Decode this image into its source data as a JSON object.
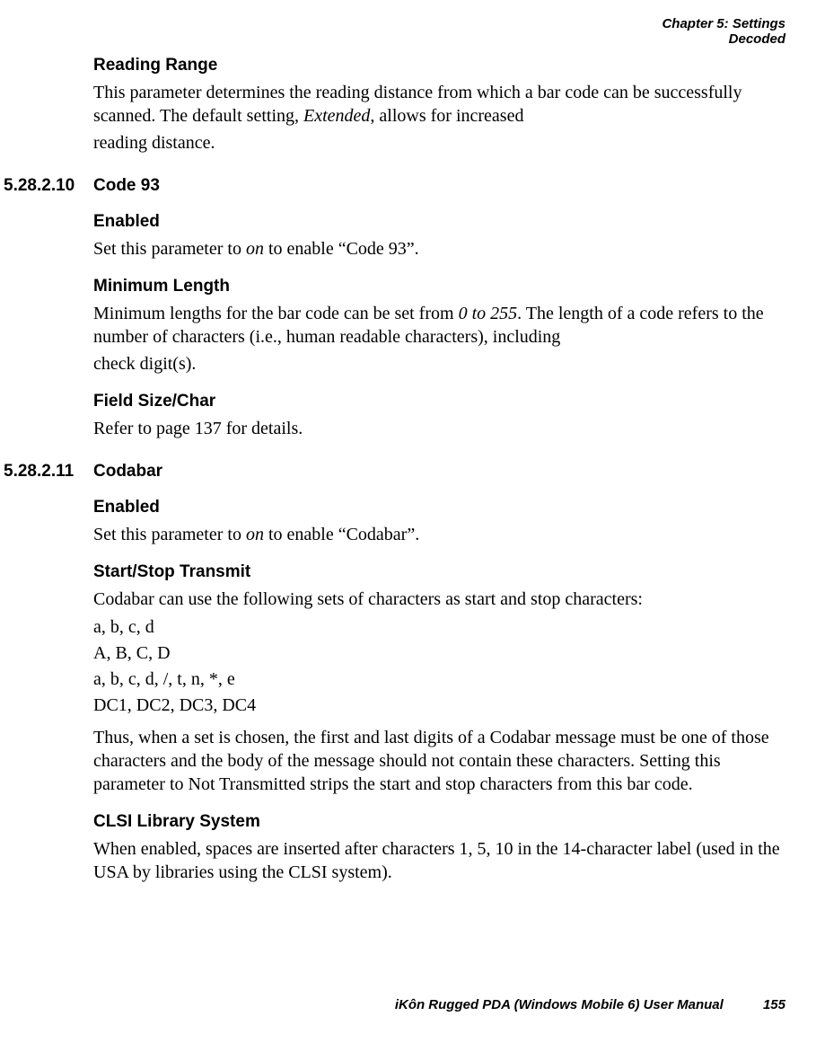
{
  "header": {
    "line1": "Chapter 5:  Settings",
    "line2": "Decoded"
  },
  "sections": {
    "reading_range": {
      "title": "Reading Range",
      "body_pre": "This parameter determines the reading distance from which a bar code can be successfully scanned. The default setting, ",
      "ital": "Extended",
      "body_post": ", allows for increased",
      "body_line2": "reading distance."
    },
    "code93": {
      "num": "5.28.2.10",
      "title": "Code 93",
      "enabled": {
        "title": "Enabled",
        "pre": "Set this parameter to ",
        "ital": "on",
        "post": " to enable “Code 93”."
      },
      "minlen": {
        "title": "Minimum Length",
        "pre": "Minimum lengths for the bar code can be set from ",
        "ital": "0 to 255",
        "post": ". The length of a code refers to the number of characters (i.e., human readable characters), including",
        "line2": "check digit(s)."
      },
      "fieldsize": {
        "title": "Field Size/Char",
        "body": "Refer to page 137 for details."
      }
    },
    "codabar": {
      "num": "5.28.2.11",
      "title": "Codabar",
      "enabled": {
        "title": "Enabled",
        "pre": "Set this parameter to ",
        "ital": "on",
        "post": " to enable “Codabar”."
      },
      "startstop": {
        "title": "Start/Stop Transmit",
        "intro": "Codabar can use the following sets of characters as start and stop characters:",
        "l1": "a, b, c, d",
        "l2": "A, B, C, D",
        "l3": "a, b, c, d, /, t, n, *, e",
        "l4": "DC1, DC2, DC3, DC4",
        "body": "Thus, when a set is chosen, the first and last digits of a Codabar message must be one of those characters and the body of the message should not contain these characters. Setting this parameter to Not Transmitted strips the start and stop characters from this bar code."
      },
      "clsi": {
        "title": "CLSI Library System",
        "body": "When enabled, spaces are inserted after characters 1, 5, 10 in the 14-character label (used in the USA by libraries using the CLSI system)."
      }
    }
  },
  "footer": {
    "text": "iKôn Rugged PDA (Windows Mobile 6) User Manual",
    "page": "155"
  }
}
